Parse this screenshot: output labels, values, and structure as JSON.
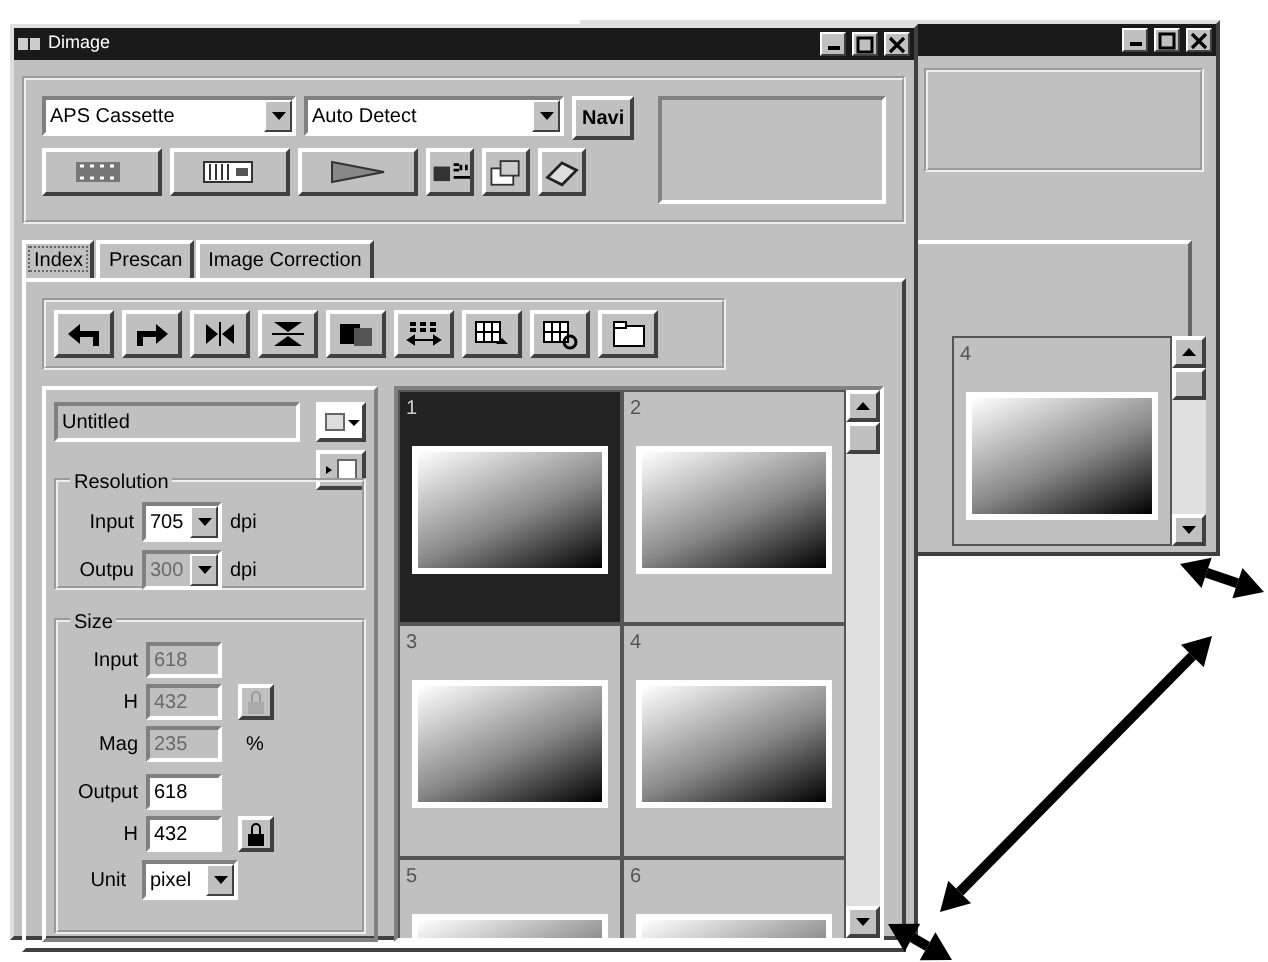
{
  "background_window": {
    "thumbnails": [
      {
        "label": "4",
        "selected": false
      }
    ]
  },
  "window": {
    "title": "Dimage"
  },
  "scanner": {
    "dropdowns": [
      {
        "value": "APS Cassette"
      },
      {
        "value": "Auto Detect"
      }
    ],
    "navi_button": "Navi"
  },
  "tabs": [
    {
      "label": "Index",
      "selected": true
    },
    {
      "label": "Prescan",
      "selected": false
    },
    {
      "label": "Image Correction",
      "selected": false
    }
  ],
  "file_name": "Untitled",
  "resolution": {
    "title": "Resolution",
    "fields": [
      {
        "label": "Input",
        "value": "705",
        "unit": "dpi",
        "disabled": false
      },
      {
        "label": "Outpu",
        "value": "300",
        "unit": "dpi",
        "disabled": true
      }
    ]
  },
  "size": {
    "title": "Size",
    "fields": [
      {
        "label": "Input",
        "value": "618",
        "disabled": true,
        "lock": false
      },
      {
        "label": "H",
        "value": "432",
        "disabled": true,
        "lock": true
      },
      {
        "label": "Mag",
        "value": "235",
        "unit": "%",
        "disabled": true,
        "lock": false
      },
      {
        "label": "Output",
        "value": "618",
        "disabled": false,
        "lock": false
      },
      {
        "label": "H",
        "value": "432",
        "disabled": false,
        "lock": true
      }
    ],
    "unit": {
      "label": "Unit",
      "value": "pixel"
    }
  },
  "thumbnails": [
    {
      "label": "1",
      "selected": true
    },
    {
      "label": "2",
      "selected": false
    },
    {
      "label": "3",
      "selected": false
    },
    {
      "label": "4",
      "selected": false
    },
    {
      "label": "5",
      "selected": false
    },
    {
      "label": "6",
      "selected": false
    }
  ]
}
